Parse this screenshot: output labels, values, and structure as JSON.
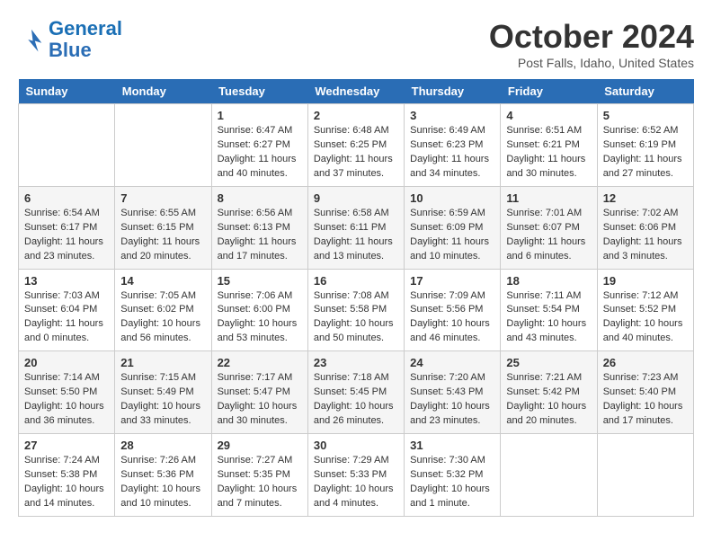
{
  "header": {
    "logo_line1": "General",
    "logo_line2": "Blue",
    "month_title": "October 2024",
    "location": "Post Falls, Idaho, United States"
  },
  "weekdays": [
    "Sunday",
    "Monday",
    "Tuesday",
    "Wednesday",
    "Thursday",
    "Friday",
    "Saturday"
  ],
  "weeks": [
    [
      {
        "day": "",
        "info": ""
      },
      {
        "day": "",
        "info": ""
      },
      {
        "day": "1",
        "info": "Sunrise: 6:47 AM\nSunset: 6:27 PM\nDaylight: 11 hours\nand 40 minutes."
      },
      {
        "day": "2",
        "info": "Sunrise: 6:48 AM\nSunset: 6:25 PM\nDaylight: 11 hours\nand 37 minutes."
      },
      {
        "day": "3",
        "info": "Sunrise: 6:49 AM\nSunset: 6:23 PM\nDaylight: 11 hours\nand 34 minutes."
      },
      {
        "day": "4",
        "info": "Sunrise: 6:51 AM\nSunset: 6:21 PM\nDaylight: 11 hours\nand 30 minutes."
      },
      {
        "day": "5",
        "info": "Sunrise: 6:52 AM\nSunset: 6:19 PM\nDaylight: 11 hours\nand 27 minutes."
      }
    ],
    [
      {
        "day": "6",
        "info": "Sunrise: 6:54 AM\nSunset: 6:17 PM\nDaylight: 11 hours\nand 23 minutes."
      },
      {
        "day": "7",
        "info": "Sunrise: 6:55 AM\nSunset: 6:15 PM\nDaylight: 11 hours\nand 20 minutes."
      },
      {
        "day": "8",
        "info": "Sunrise: 6:56 AM\nSunset: 6:13 PM\nDaylight: 11 hours\nand 17 minutes."
      },
      {
        "day": "9",
        "info": "Sunrise: 6:58 AM\nSunset: 6:11 PM\nDaylight: 11 hours\nand 13 minutes."
      },
      {
        "day": "10",
        "info": "Sunrise: 6:59 AM\nSunset: 6:09 PM\nDaylight: 11 hours\nand 10 minutes."
      },
      {
        "day": "11",
        "info": "Sunrise: 7:01 AM\nSunset: 6:07 PM\nDaylight: 11 hours\nand 6 minutes."
      },
      {
        "day": "12",
        "info": "Sunrise: 7:02 AM\nSunset: 6:06 PM\nDaylight: 11 hours\nand 3 minutes."
      }
    ],
    [
      {
        "day": "13",
        "info": "Sunrise: 7:03 AM\nSunset: 6:04 PM\nDaylight: 11 hours\nand 0 minutes."
      },
      {
        "day": "14",
        "info": "Sunrise: 7:05 AM\nSunset: 6:02 PM\nDaylight: 10 hours\nand 56 minutes."
      },
      {
        "day": "15",
        "info": "Sunrise: 7:06 AM\nSunset: 6:00 PM\nDaylight: 10 hours\nand 53 minutes."
      },
      {
        "day": "16",
        "info": "Sunrise: 7:08 AM\nSunset: 5:58 PM\nDaylight: 10 hours\nand 50 minutes."
      },
      {
        "day": "17",
        "info": "Sunrise: 7:09 AM\nSunset: 5:56 PM\nDaylight: 10 hours\nand 46 minutes."
      },
      {
        "day": "18",
        "info": "Sunrise: 7:11 AM\nSunset: 5:54 PM\nDaylight: 10 hours\nand 43 minutes."
      },
      {
        "day": "19",
        "info": "Sunrise: 7:12 AM\nSunset: 5:52 PM\nDaylight: 10 hours\nand 40 minutes."
      }
    ],
    [
      {
        "day": "20",
        "info": "Sunrise: 7:14 AM\nSunset: 5:50 PM\nDaylight: 10 hours\nand 36 minutes."
      },
      {
        "day": "21",
        "info": "Sunrise: 7:15 AM\nSunset: 5:49 PM\nDaylight: 10 hours\nand 33 minutes."
      },
      {
        "day": "22",
        "info": "Sunrise: 7:17 AM\nSunset: 5:47 PM\nDaylight: 10 hours\nand 30 minutes."
      },
      {
        "day": "23",
        "info": "Sunrise: 7:18 AM\nSunset: 5:45 PM\nDaylight: 10 hours\nand 26 minutes."
      },
      {
        "day": "24",
        "info": "Sunrise: 7:20 AM\nSunset: 5:43 PM\nDaylight: 10 hours\nand 23 minutes."
      },
      {
        "day": "25",
        "info": "Sunrise: 7:21 AM\nSunset: 5:42 PM\nDaylight: 10 hours\nand 20 minutes."
      },
      {
        "day": "26",
        "info": "Sunrise: 7:23 AM\nSunset: 5:40 PM\nDaylight: 10 hours\nand 17 minutes."
      }
    ],
    [
      {
        "day": "27",
        "info": "Sunrise: 7:24 AM\nSunset: 5:38 PM\nDaylight: 10 hours\nand 14 minutes."
      },
      {
        "day": "28",
        "info": "Sunrise: 7:26 AM\nSunset: 5:36 PM\nDaylight: 10 hours\nand 10 minutes."
      },
      {
        "day": "29",
        "info": "Sunrise: 7:27 AM\nSunset: 5:35 PM\nDaylight: 10 hours\nand 7 minutes."
      },
      {
        "day": "30",
        "info": "Sunrise: 7:29 AM\nSunset: 5:33 PM\nDaylight: 10 hours\nand 4 minutes."
      },
      {
        "day": "31",
        "info": "Sunrise: 7:30 AM\nSunset: 5:32 PM\nDaylight: 10 hours\nand 1 minute."
      },
      {
        "day": "",
        "info": ""
      },
      {
        "day": "",
        "info": ""
      }
    ]
  ]
}
